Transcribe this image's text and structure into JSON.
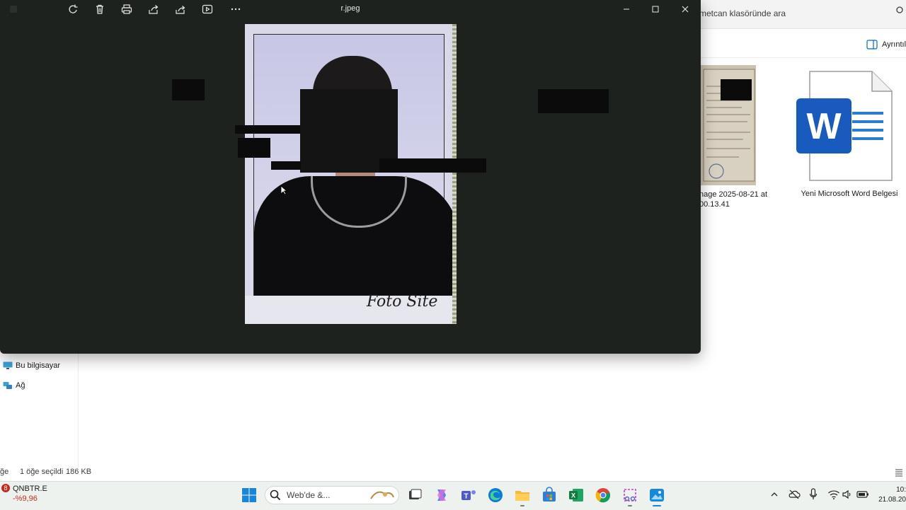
{
  "explorer": {
    "search_text": "metcan klasöründe ara",
    "details_label": "Ayrıntıla",
    "files": [
      {
        "label_line1": "nage 2025-08-21 at",
        "label_line2": "00.13.41"
      },
      {
        "label": "Yeni Microsoft Word Belgesi"
      }
    ],
    "nav": {
      "this_pc": "Bu bilgisayar",
      "network": "Ağ"
    },
    "status": {
      "left": "ğe",
      "selected": "1 öğe seçildi",
      "size": "186 KB"
    }
  },
  "viewer": {
    "title": "r.jpeg",
    "toolbar_icons": [
      "rotate-icon",
      "delete-icon",
      "print-icon",
      "share-icon",
      "export-icon",
      "slideshow-icon",
      "more-icon"
    ],
    "photo_watermark": "Foto Site"
  },
  "taskbar": {
    "stock": {
      "badge": "8",
      "name": "QNBTR.E",
      "change": "-%9,96"
    },
    "search_placeholder": "Web'de &...",
    "clock_time": "10:",
    "clock_date": "21.08.20"
  },
  "colors": {
    "viewer_bg": "#1d221f",
    "accent_blue": "#0067c0",
    "word_blue": "#185abd",
    "stock_red": "#c42b1c"
  }
}
